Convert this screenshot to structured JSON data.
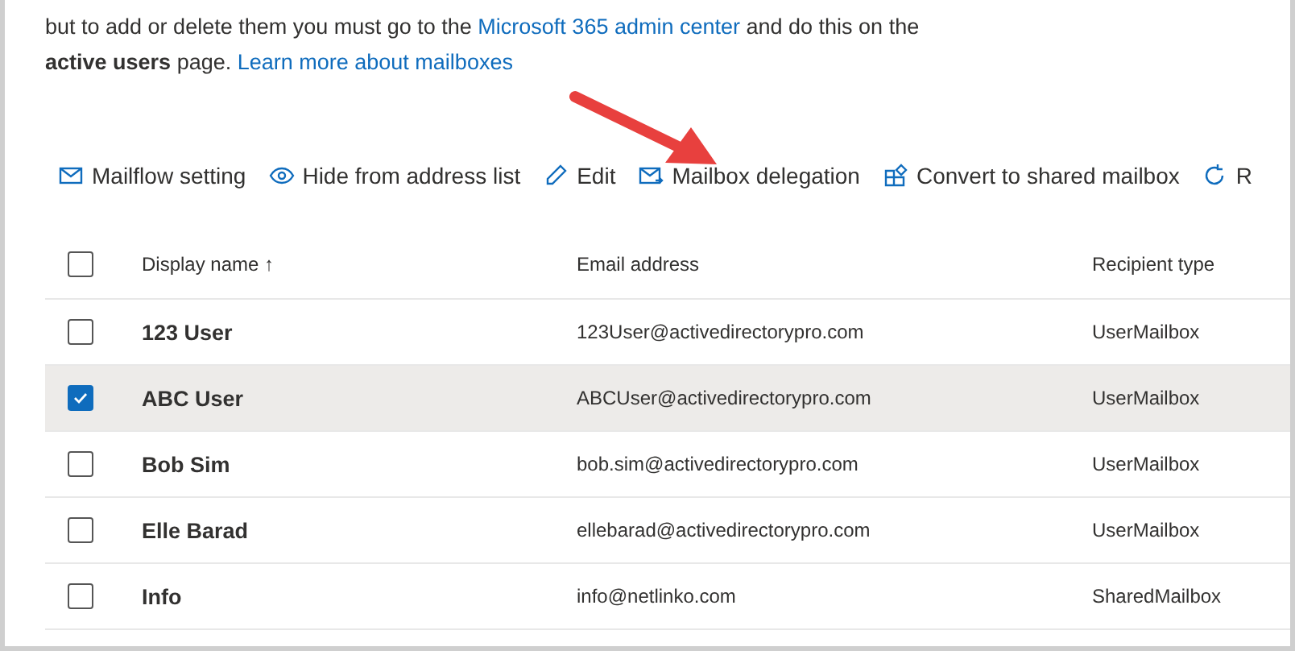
{
  "intro": {
    "line_1_parts": [
      "but to add or delete them you must go to the ",
      "Microsoft 365 admin center",
      " and do this on the"
    ],
    "line_2_bold": "active users",
    "line_2_text": " page. ",
    "line_2_link": "Learn more about mailboxes"
  },
  "toolbar": [
    "Mailflow setting",
    "Hide from address list",
    "Edit",
    "Mailbox delegation",
    "Convert to shared mailbox",
    "R"
  ],
  "table": {
    "columns": [
      "Display name ↑",
      "Email address",
      "Recipient type"
    ],
    "all_checked": false,
    "rows": [
      {
        "name": "123 User",
        "email": "123User@activedirectorypro.com",
        "type": "UserMailbox",
        "selected": false
      },
      {
        "name": "ABC User",
        "email": "ABCUser@activedirectorypro.com",
        "type": "UserMailbox",
        "selected": true
      },
      {
        "name": "Bob Sim",
        "email": "bob.sim@activedirectorypro.com",
        "type": "UserMailbox",
        "selected": false
      },
      {
        "name": "Elle Barad",
        "email": "ellebarad@activedirectorypro.com",
        "type": "UserMailbox",
        "selected": false
      },
      {
        "name": "Info",
        "email": "info@netlinko.com",
        "type": "SharedMailbox",
        "selected": false
      }
    ]
  }
}
